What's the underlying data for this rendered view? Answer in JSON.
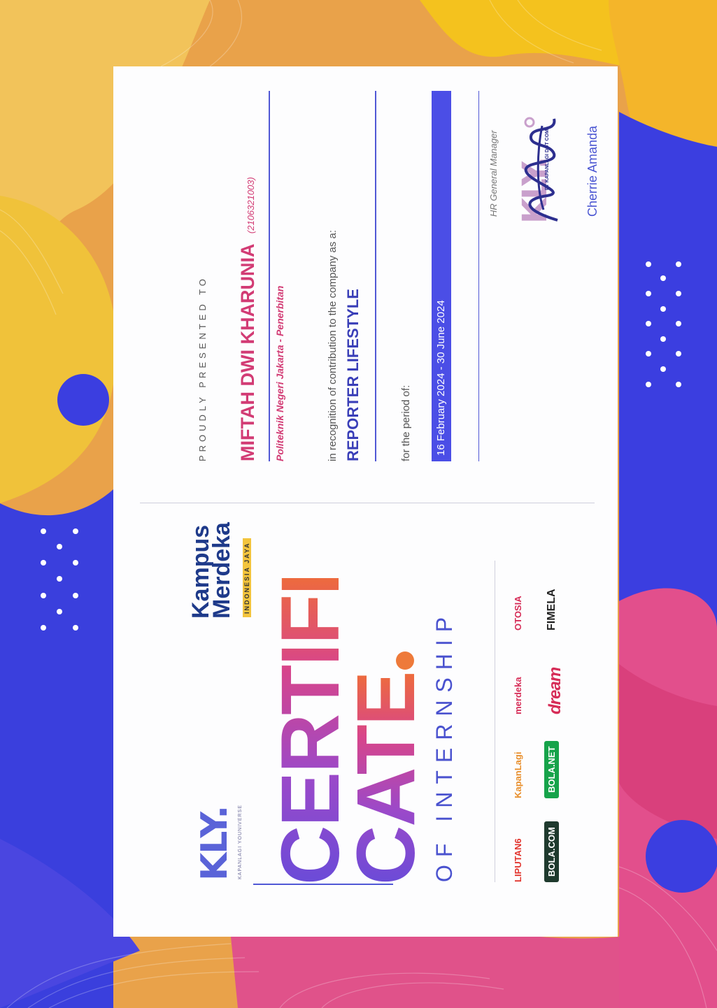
{
  "page": {
    "colors": {
      "orange": "#e9a24a",
      "blue": "#3b3ee0",
      "pink": "#e24f8c",
      "yellow": "#f4c21e",
      "card": "#fdfdfe"
    }
  },
  "certificate": {
    "logos": {
      "kly": "KLY.",
      "kly_tagline": "KAPANLAGI YOUNIVERSE",
      "kampus_line1": "Kampus",
      "kampus_line2": "Merdeka",
      "kampus_badge": "INDONESIA JAYA"
    },
    "title_line1": "CERTIFI",
    "title_line2": "CATE",
    "subtitle": "OF INTERNSHIP",
    "brands": [
      {
        "label": "LIPUTAN6",
        "color": "#e2352e",
        "bg": ""
      },
      {
        "label": "KapanLagi",
        "color": "#e88e2b",
        "bg": ""
      },
      {
        "label": "merdeka",
        "color": "#d62c57",
        "bg": ""
      },
      {
        "label": "OTOSIA",
        "color": "#d62c57",
        "bg": ""
      },
      {
        "label": "BOLA.COM",
        "color": "#ffffff",
        "bg": "#1f3a2e"
      },
      {
        "label": "BOLA.NET",
        "color": "#ffffff",
        "bg": "#16a34a"
      },
      {
        "label": "dream",
        "color": "#d62c57",
        "bg": ""
      },
      {
        "label": "FIMELA",
        "color": "#1f1f1f",
        "bg": ""
      }
    ],
    "presented_label": "PROUDLY PRESENTED TO",
    "recipient_name": "MIFTAH DWI KHARUNIA",
    "recipient_id": "(2106321003)",
    "institution": "Politeknik Negeri Jakarta - Penerbitan",
    "recognition_text": "in recognition of  contribution to the company as a:",
    "position": "REPORTER LIFESTYLE",
    "period_label": "for the period of:",
    "period": "16 February 2024 - 30 June 2024",
    "signer_title": "HR General Manager",
    "stamp_text": "PT KAPANLAGI DOT COM",
    "signer_name": "Cherrie Amanda"
  }
}
